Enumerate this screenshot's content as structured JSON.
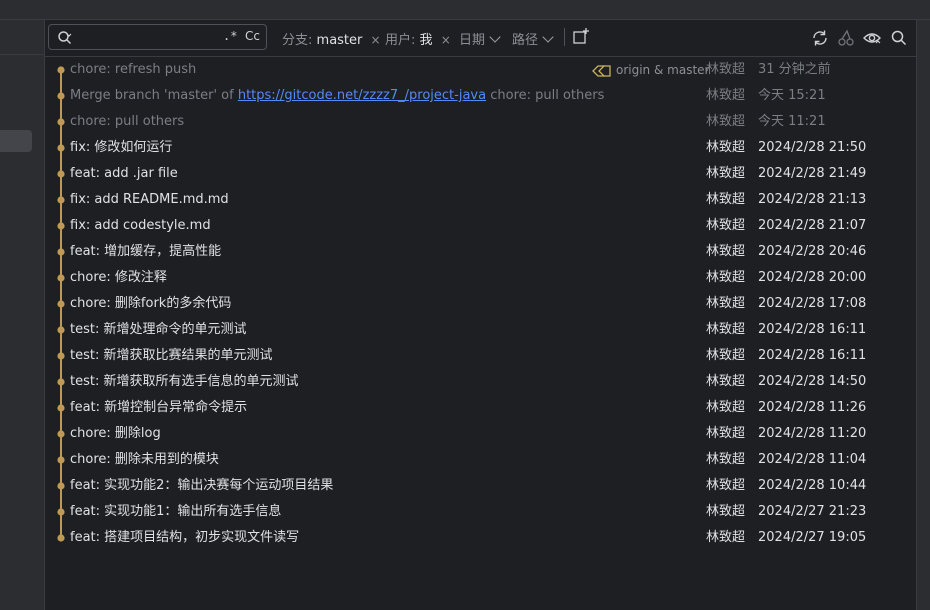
{
  "toolbar": {
    "search_value": "",
    "regex_label": ".*",
    "match_case_label": "Cc",
    "branch_filter": {
      "label": "分支:",
      "value": "master",
      "clear": "×"
    },
    "user_filter": {
      "label": "用户:",
      "value": "我",
      "clear": "×"
    },
    "date_filter": {
      "label": "日期"
    },
    "path_filter": {
      "label": "路径"
    },
    "icons": [
      "new-tab-icon",
      "refresh-icon",
      "cherry-pick-icon",
      "eye-icon",
      "search-icon"
    ]
  },
  "colors": {
    "graph_line": "#c09a52",
    "link": "#548af7",
    "dim_text": "#7a7e85",
    "text": "#dfe1e5",
    "tag": "#c9b35a"
  },
  "commits": [
    {
      "subject": "chore: refresh push",
      "refs": "origin & master",
      "author": "林致超",
      "date": "31 分钟之前",
      "dim": true
    },
    {
      "subject_pre": "Merge branch 'master' of ",
      "subject_link": "https://gitcode.net/zzzz7_/project-java",
      "subject_post": " chore: pull others",
      "author": "林致超",
      "date": "今天 15:21",
      "dim": true
    },
    {
      "subject": "chore: pull others",
      "author": "林致超",
      "date": "今天 11:21",
      "dim": true
    },
    {
      "subject": "fix: 修改如何运行",
      "author": "林致超",
      "date": "2024/2/28 21:50"
    },
    {
      "subject": "feat: add .jar file",
      "author": "林致超",
      "date": "2024/2/28 21:49"
    },
    {
      "subject": "fix: add README.md.md",
      "author": "林致超",
      "date": "2024/2/28 21:13"
    },
    {
      "subject": "fix: add codestyle.md",
      "author": "林致超",
      "date": "2024/2/28 21:07"
    },
    {
      "subject": "feat: 增加缓存，提高性能",
      "author": "林致超",
      "date": "2024/2/28 20:46"
    },
    {
      "subject": "chore: 修改注释",
      "author": "林致超",
      "date": "2024/2/28 20:00"
    },
    {
      "subject": "chore: 删除fork的多余代码",
      "author": "林致超",
      "date": "2024/2/28 17:08"
    },
    {
      "subject": "test: 新增处理命令的单元测试",
      "author": "林致超",
      "date": "2024/2/28 16:11"
    },
    {
      "subject": "test: 新增获取比赛结果的单元测试",
      "author": "林致超",
      "date": "2024/2/28 16:11"
    },
    {
      "subject": "test: 新增获取所有选手信息的单元测试",
      "author": "林致超",
      "date": "2024/2/28 14:50"
    },
    {
      "subject": "feat: 新增控制台异常命令提示",
      "author": "林致超",
      "date": "2024/2/28 11:26"
    },
    {
      "subject": "chore: 删除log",
      "author": "林致超",
      "date": "2024/2/28 11:20"
    },
    {
      "subject": "chore: 删除未用到的模块",
      "author": "林致超",
      "date": "2024/2/28 11:04"
    },
    {
      "subject": "feat: 实现功能2：输出决赛每个运动项目结果",
      "author": "林致超",
      "date": "2024/2/28 10:44"
    },
    {
      "subject": "feat: 实现功能1：输出所有选手信息",
      "author": "林致超",
      "date": "2024/2/27 21:23"
    },
    {
      "subject": "feat: 搭建项目结构，初步实现文件读写",
      "author": "林致超",
      "date": "2024/2/27 19:05"
    }
  ]
}
